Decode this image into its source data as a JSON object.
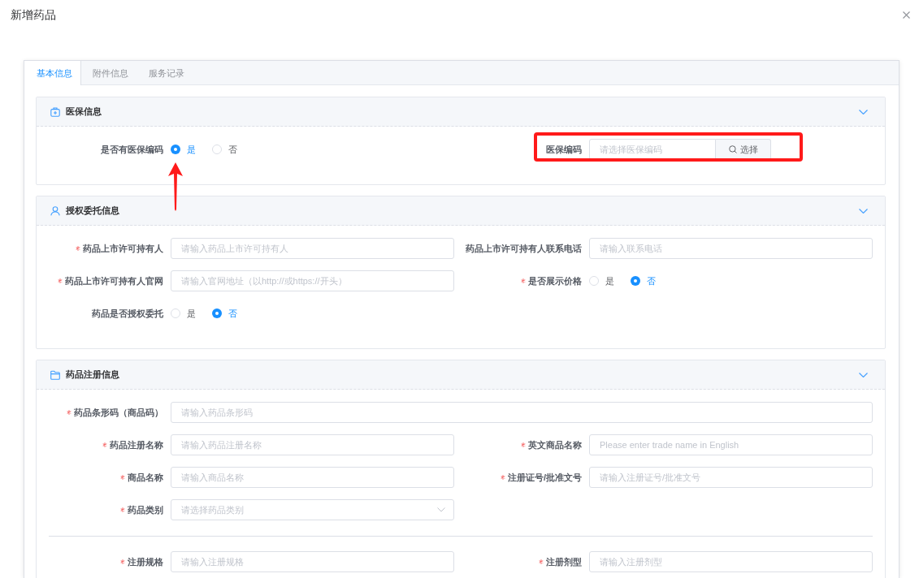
{
  "dialog": {
    "title": "新增药品"
  },
  "tabs": [
    {
      "label": "基本信息",
      "selected": true
    },
    {
      "label": "附件信息",
      "selected": false
    },
    {
      "label": "服务记录",
      "selected": false
    }
  ],
  "sections": [
    {
      "title": "医保信息",
      "expanded": true,
      "rows": [
        {
          "kind": "pair",
          "fields": [
            {
              "kind": "radio",
              "label": "是否有医保编码",
              "required": false,
              "options": [
                {
                  "label": "是",
                  "selected": true,
                  "pointed": true
                },
                {
                  "label": "否",
                  "selected": false,
                  "pointed": false
                }
              ]
            },
            {
              "kind": "lookup",
              "label": "医保编码",
              "required": false,
              "placeholder": "请选择医保编码",
              "button": "选择",
              "highlighted": true
            }
          ]
        }
      ]
    },
    {
      "title": "授权委托信息",
      "expanded": true,
      "rows": [
        {
          "kind": "pair",
          "fields": [
            {
              "kind": "text",
              "label": "药品上市许可持有人",
              "required": true,
              "placeholder": "请输入药品上市许可持有人"
            },
            {
              "kind": "text",
              "label": "药品上市许可持有人联系电话",
              "required": false,
              "placeholder": "请输入联系电话"
            }
          ]
        },
        {
          "kind": "pair",
          "fields": [
            {
              "kind": "text",
              "label": "药品上市许可持有人官网",
              "required": true,
              "placeholder": "请输入官网地址（以http://或https://开头）"
            },
            {
              "kind": "radio",
              "label": "是否展示价格",
              "required": true,
              "options": [
                {
                  "label": "是",
                  "selected": false
                },
                {
                  "label": "否",
                  "selected": true
                }
              ]
            }
          ]
        },
        {
          "kind": "pair",
          "fields": [
            {
              "kind": "radio",
              "label": "药品是否授权委托",
              "required": false,
              "options": [
                {
                  "label": "是",
                  "selected": false
                },
                {
                  "label": "否",
                  "selected": true
                }
              ]
            }
          ]
        }
      ]
    },
    {
      "title": "药品注册信息",
      "expanded": true,
      "rows": [
        {
          "kind": "wide",
          "fields": [
            {
              "kind": "text",
              "label": "药品条形码（商品码）",
              "required": true,
              "placeholder": "请输入药品条形码"
            }
          ]
        },
        {
          "kind": "pair",
          "fields": [
            {
              "kind": "text",
              "label": "药品注册名称",
              "required": true,
              "placeholder": "请输入药品注册名称"
            },
            {
              "kind": "text",
              "label": "英文商品名称",
              "required": true,
              "placeholder": "Please enter trade name in English"
            }
          ]
        },
        {
          "kind": "pair",
          "fields": [
            {
              "kind": "text",
              "label": "商品名称",
              "required": true,
              "placeholder": "请输入商品名称"
            },
            {
              "kind": "text",
              "label": "注册证号/批准文号",
              "required": true,
              "placeholder": "请输入注册证号/批准文号"
            }
          ]
        },
        {
          "kind": "pair",
          "fields": [
            {
              "kind": "select",
              "label": "药品类别",
              "required": true,
              "placeholder": "请选择药品类别"
            }
          ]
        },
        {
          "kind": "divider"
        },
        {
          "kind": "pair",
          "fields": [
            {
              "kind": "text",
              "label": "注册规格",
              "required": true,
              "placeholder": "请输入注册规格"
            },
            {
              "kind": "text",
              "label": "注册剂型",
              "required": true,
              "placeholder": "请输入注册剂型"
            }
          ]
        }
      ]
    }
  ]
}
